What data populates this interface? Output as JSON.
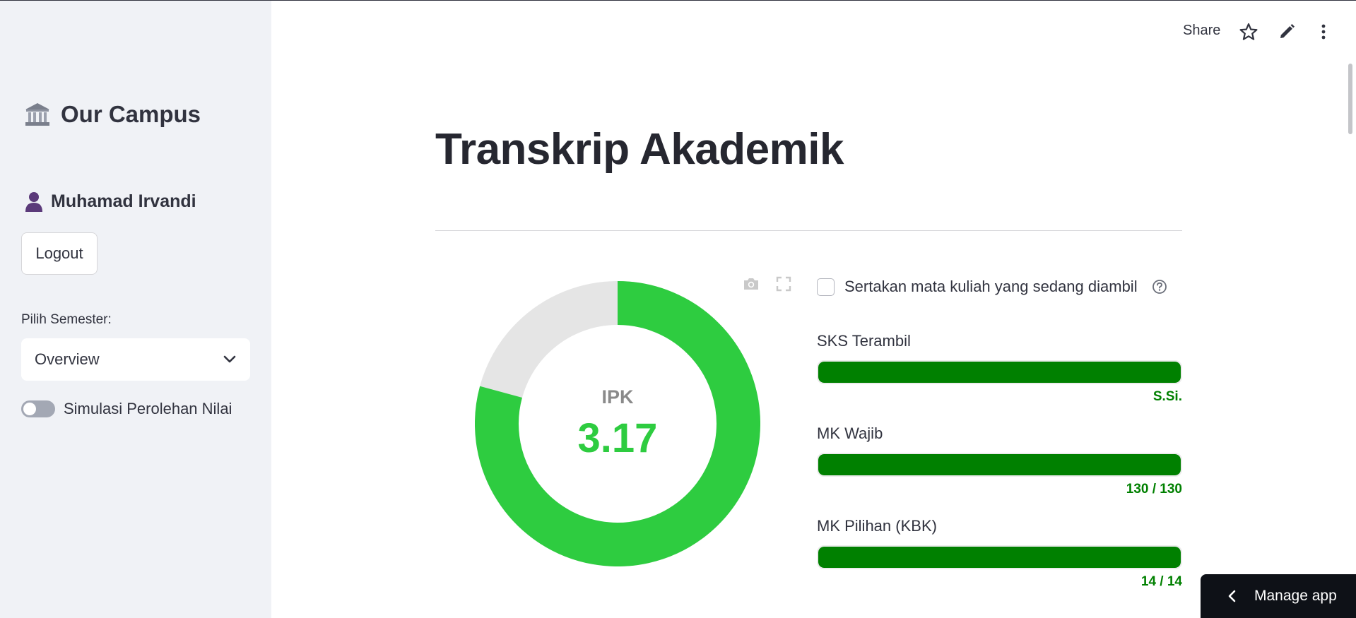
{
  "sidebar": {
    "brand": "Our Campus",
    "user_name": "Muhamad Irvandi",
    "logout_label": "Logout",
    "semester_label": "Pilih Semester:",
    "semester_value": "Overview",
    "toggle_label": "Simulasi Perolehan Nilai",
    "toggle_on": false
  },
  "header": {
    "share_label": "Share",
    "icons": [
      "star-icon",
      "edit-icon",
      "more-vert-icon"
    ]
  },
  "main": {
    "title": "Transkrip Akademik",
    "ipk_label": "IPK",
    "ipk_value": "3.17",
    "checkbox_label": "Sertakan mata kuliah yang sedang diambil",
    "checkbox_checked": false,
    "progress": [
      {
        "label": "SKS Terambil",
        "value_text": "S.Si.",
        "fraction": 1.0
      },
      {
        "label": "MK Wajib",
        "value_text": "130 / 130",
        "fraction": 1.0
      },
      {
        "label": "MK Pilihan (KBK)",
        "value_text": "14 / 14",
        "fraction": 1.0
      }
    ]
  },
  "chart_data": {
    "type": "pie",
    "hole": true,
    "center_label": "IPK",
    "center_value": "3.17",
    "values": [
      3.17,
      0.83
    ],
    "max": 4.0,
    "colors": [
      "#2ecc40",
      "#e5e5e5"
    ]
  },
  "manage_label": "Manage app",
  "colors": {
    "accent_green": "#2ecc40",
    "progress_green": "#008000",
    "sidebar_bg": "#f0f2f6",
    "dark": "#0e1117"
  }
}
